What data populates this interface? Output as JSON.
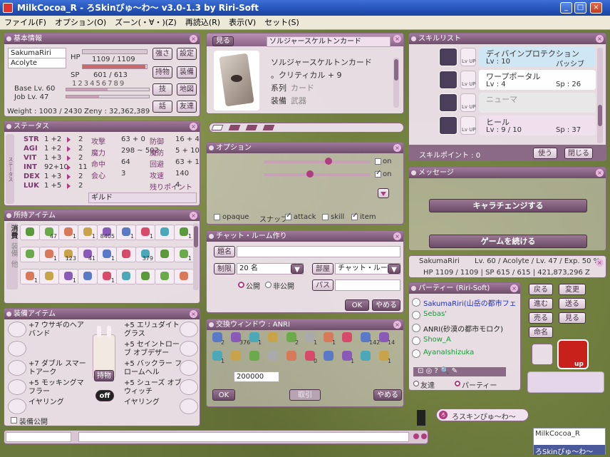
{
  "window": {
    "title": "MilkCocoa_R - ろSkinぴゅ～わ～ v3.0-1.3 by Riri-Soft"
  },
  "menu": [
    "ファイル(F)",
    "オプション(O)",
    "ズーン(・∀・)(Z)",
    "再読込(R)",
    "表示(V)",
    "セット(S)"
  ],
  "basic": {
    "title": "基本情報",
    "name": "SakumaRiri",
    "job": "Acolyte",
    "hp_label": "HP",
    "hp": "1109 / 1109",
    "hp_fraction": 1.0,
    "sp_label": "SP",
    "sp": "601 / 613",
    "sp_fraction": 0.98,
    "digits": "123456789",
    "base": "Base Lv. 60",
    "joblv": "Job Lv. 47",
    "weight": "Weight : 1003 / 2430",
    "zeny": "Zeny : 32,362,389",
    "buttons": [
      "強さ",
      "設定",
      "持物",
      "装備",
      "技",
      "地図",
      "話",
      "友達"
    ]
  },
  "status": {
    "title": "ステータス",
    "side": "ステータス",
    "stats": [
      {
        "name": "STR",
        "value": "1 +2",
        "points": "2"
      },
      {
        "name": "AGI",
        "value": "1 +2",
        "points": "2"
      },
      {
        "name": "VIT",
        "value": "1 +3",
        "points": "2"
      },
      {
        "name": "INT",
        "value": "92+10",
        "points": "11"
      },
      {
        "name": "DEX",
        "value": "1 +3",
        "points": "2"
      },
      {
        "name": "LUK",
        "value": "1 +5",
        "points": "2"
      }
    ],
    "rows": [
      {
        "l": "攻撃",
        "v": "63 + 0",
        "l2": "防御",
        "v2": "16 + 4"
      },
      {
        "l": "魔力",
        "v": "298 ~ 502",
        "l2": "魔防",
        "v2": "5 + 102"
      },
      {
        "l": "命中",
        "v": "64",
        "l2": "回避",
        "v2": "63 + 1"
      },
      {
        "l": "会心",
        "v": "3",
        "l2": "攻速",
        "v2": "140"
      },
      {
        "l": "",
        "v": "",
        "l2": "残りポイント",
        "v2": "4"
      }
    ],
    "guild": "ギルド"
  },
  "inventory": {
    "title": "所持アイテム",
    "tabs": [
      "消費",
      "装備",
      "他"
    ],
    "counts": [
      "",
      "47",
      "1",
      "1",
      "8405",
      "1",
      "1",
      "",
      "1",
      "",
      "1",
      "123",
      "41",
      "1",
      "",
      "379",
      "",
      "1",
      "1",
      "",
      "1",
      "",
      "1",
      "",
      "",
      "",
      ""
    ]
  },
  "card": {
    "title": "見る",
    "name_field": "ソルジャースケルトンカード",
    "name": "ソルジャースケルトンカード",
    "effect": "。クリティカル + 9",
    "type_label": "系列",
    "type_value": "カード",
    "equip_label": "装備",
    "equip_value": "武器"
  },
  "option": {
    "title": "オプション",
    "on1": "on",
    "on2": "on",
    "opaque": "opaque",
    "snap": "スナップ",
    "attack": "attack",
    "skill": "skill",
    "item": "item"
  },
  "chat": {
    "title": "チャット・ルーム作り",
    "t_label": "題名",
    "limit_label": "制限",
    "limit": "20 名",
    "room_label": "部屋",
    "room": "チャット・ルー",
    "public": "公開",
    "private": "非公開",
    "pass_label": "パス",
    "ok": "OK",
    "cancel": "やめる"
  },
  "trade": {
    "title": "交換ウィンドウ : ANRI",
    "counts": [
      "2",
      "376",
      "1",
      "",
      "2",
      "1",
      "1",
      "",
      "142",
      "14",
      "1",
      "",
      "",
      "",
      "",
      "0",
      "",
      "1",
      "",
      "1"
    ],
    "amount": "200000",
    "ok": "OK",
    "trade": "取引",
    "cancel": "やめる"
  },
  "equip": {
    "title": "装備アイテム",
    "left": [
      "+7 ウサギのヘアバンド",
      "",
      "+7 ダブル スマートアーク",
      "+5 モッキングマフラー",
      "イヤリング"
    ],
    "right": [
      "+5 エリュダイトグラス",
      "+5 セイントローブ オブデザー",
      "+5 バックラー フロームヘル",
      "+5 シューズ オブ ウィッチ",
      "イヤリング"
    ],
    "item_btn": "持物",
    "off": "off",
    "public": "装備公開"
  },
  "skills": {
    "title": "スキルリスト",
    "list": [
      {
        "name": "ディバインプロテクション",
        "lv": "Lv : 10",
        "sp": "パッシブ",
        "lvup": "Lv UP"
      },
      {
        "name": "ワープポータル",
        "lv": "Lv : 4",
        "sp": "Sp : 26",
        "lvup": "Lv UP"
      },
      {
        "name": "ニューマ",
        "lv": "",
        "sp": "",
        "lvup": "Lv UP"
      },
      {
        "name": "ヒール",
        "lv": "Lv : 9 / 10",
        "sp": "Sp : 37",
        "lvup": "Lv UP"
      }
    ],
    "points": "スキルポイント : 0",
    "use": "使う",
    "close": "閉じる"
  },
  "message": {
    "title": "メッセージ",
    "change": "キャラチェンジする",
    "continue": "ゲームを続ける"
  },
  "char": {
    "name": "SakumaRiri",
    "info": "Lv. 60 / Acolyte / Lv. 47 / Exp. 50 %",
    "hp": "HP 1109 / 1109 | SP 615 / 615 | 421,873,296 Z"
  },
  "party": {
    "title": "パーティー (Riri-Soft)",
    "members": [
      {
        "name": "SakumaRiri(山岳の都市フェ",
        "color": "#1b2fd0",
        "icon": "check-icon"
      },
      {
        "name": "Sebas'",
        "color": "#1a9a3a",
        "icon": "on-icon"
      },
      {
        "name": "ANRI(砂漠の都市モロク)",
        "color": "#222222",
        "icon": "off-icon"
      },
      {
        "name": "Show_A",
        "color": "#1a9a3a",
        "icon": "blank-icon"
      },
      {
        "name": "AyanaIshizuka",
        "color": "#1a9a3a",
        "icon": "blank-icon"
      }
    ],
    "friends": "友達",
    "party": "パーティー"
  },
  "side": {
    "buttons": [
      "戻る",
      "変更",
      "進む",
      "送る",
      "売る",
      "見る",
      "命名"
    ],
    "up": "up"
  },
  "chatlog": {
    "line": "ろスキンぴゅ～わ～"
  },
  "footer": {
    "name": "MilkCocoa_R",
    "skin": "ろSkinぴゅ～わ～"
  }
}
